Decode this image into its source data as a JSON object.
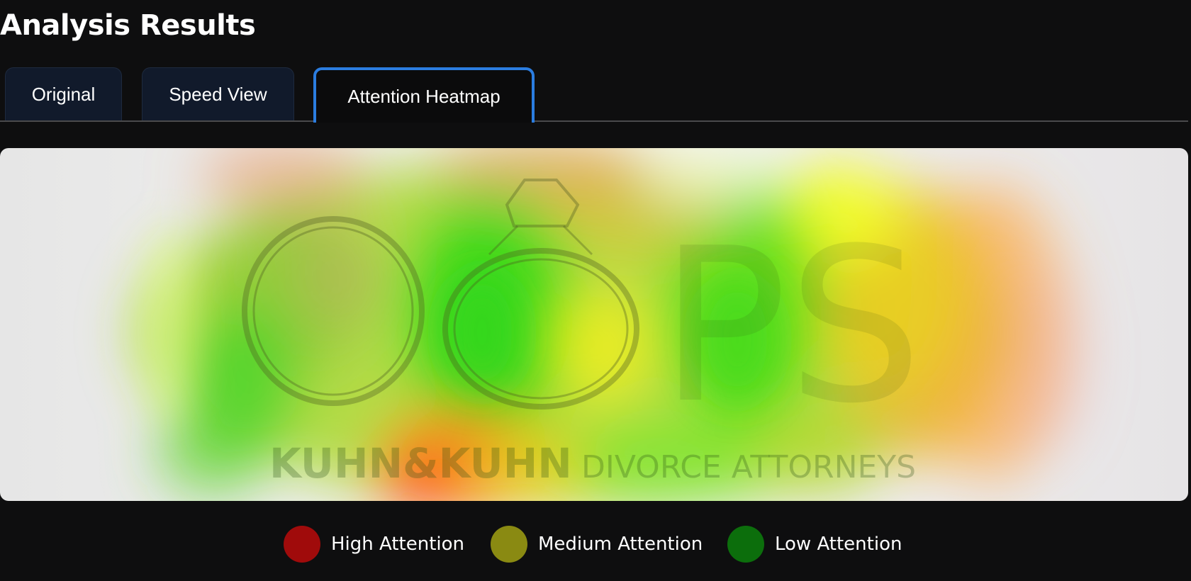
{
  "page": {
    "title": "Analysis Results"
  },
  "tabs": [
    {
      "label": "Original",
      "active": false
    },
    {
      "label": "Speed View",
      "active": false
    },
    {
      "label": "Attention Heatmap",
      "active": true
    }
  ],
  "image": {
    "logo_text": "OOPS",
    "brand_text": "KUHN&KUHN",
    "tagline_text": "DIVORCE ATTORNEYS"
  },
  "legend": [
    {
      "label": "High Attention",
      "color": "#a00b0b"
    },
    {
      "label": "Medium Attention",
      "color": "#8a8a12"
    },
    {
      "label": "Low Attention",
      "color": "#0c6e0c"
    }
  ],
  "colors": {
    "background": "#0e0e0f",
    "tab_bg": "#111a2b",
    "tab_active_border": "#2b7de0",
    "text": "#ffffff"
  }
}
